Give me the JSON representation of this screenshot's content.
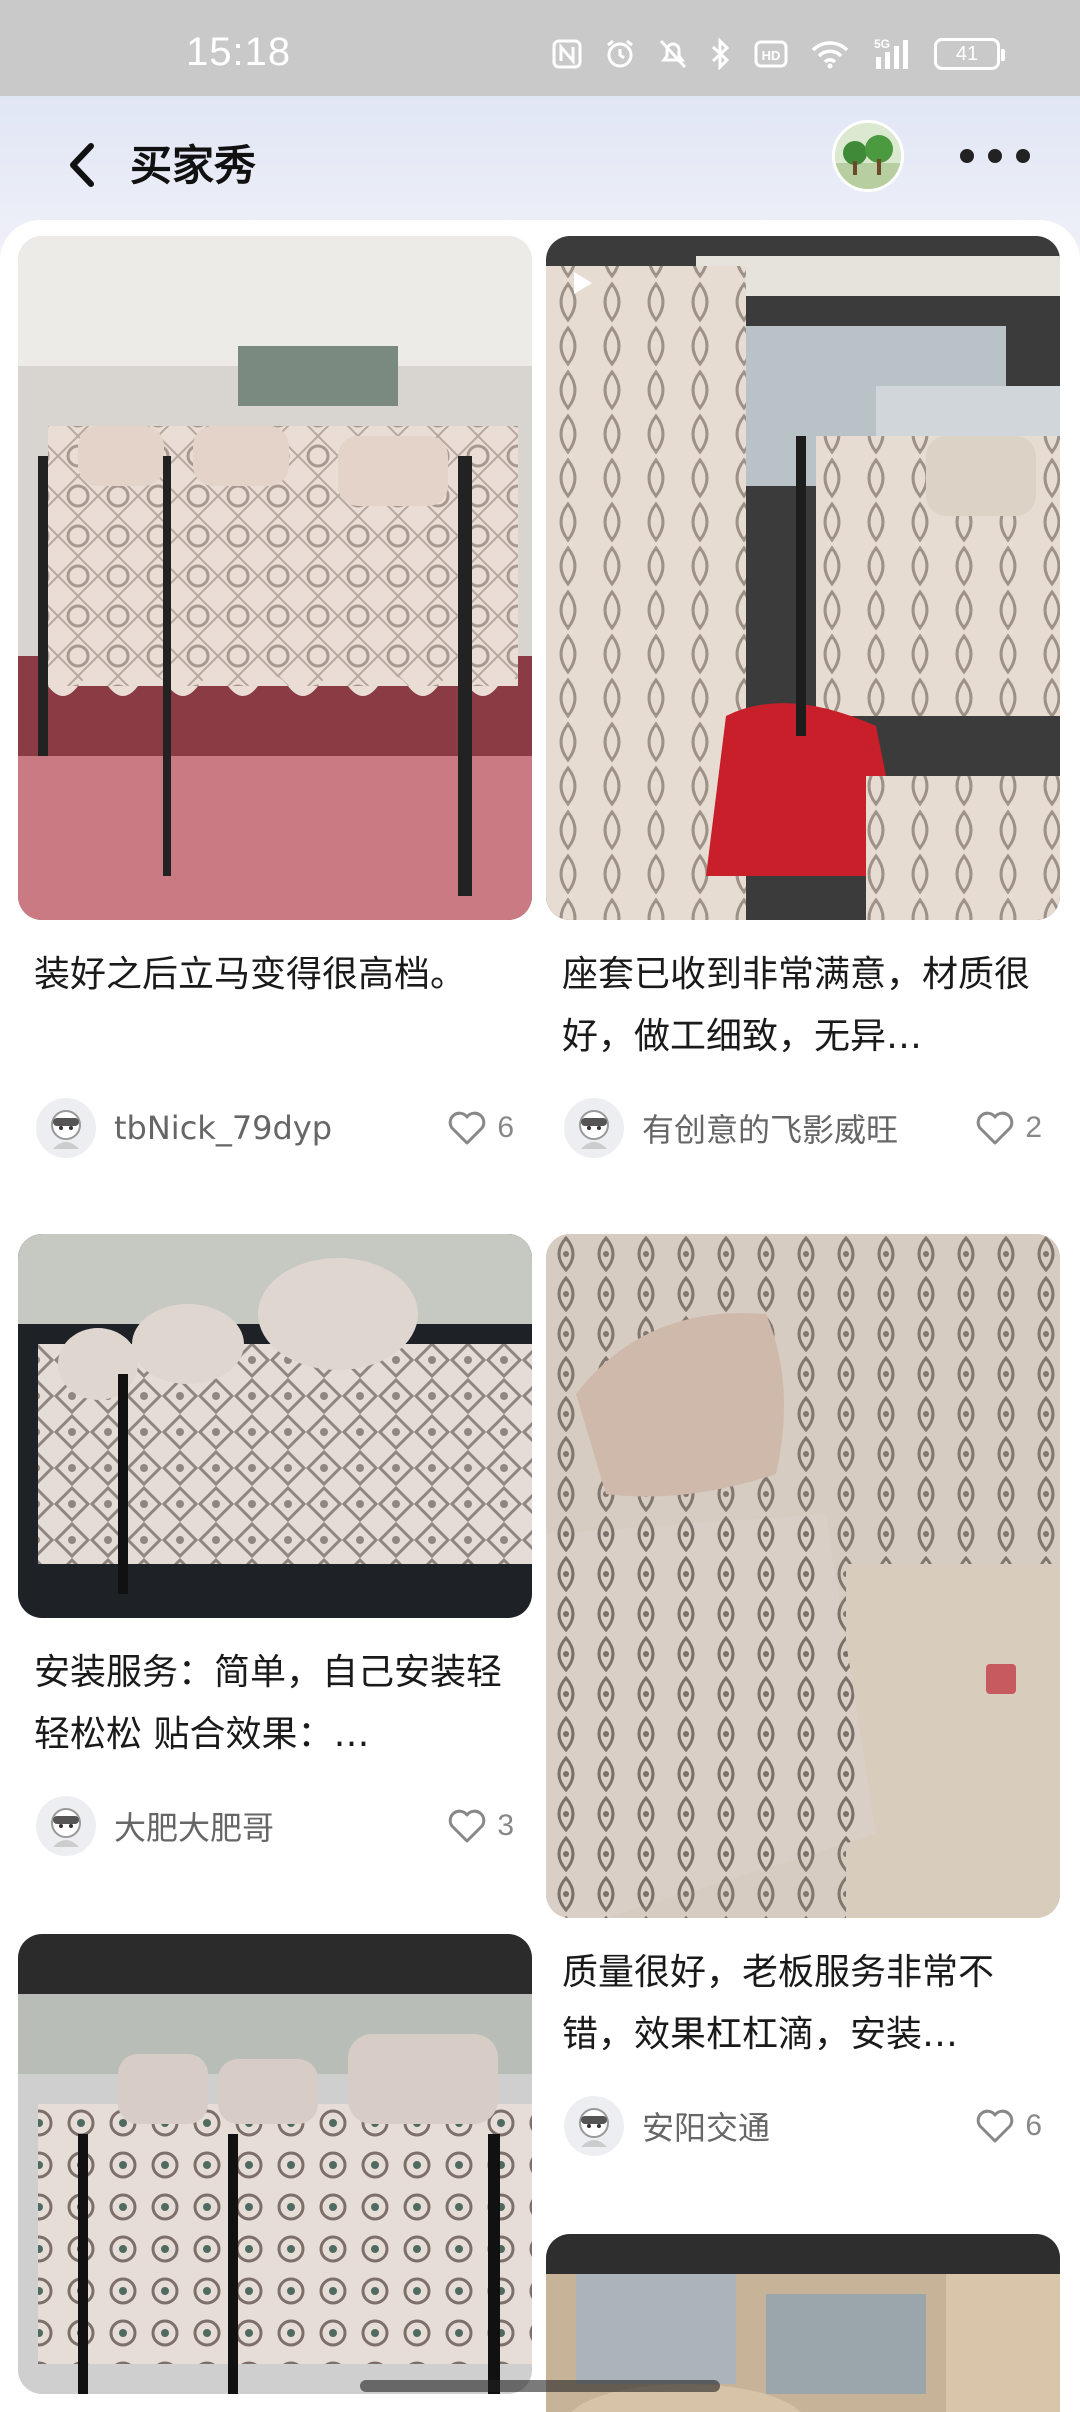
{
  "status_bar": {
    "time": "15:18",
    "network": "5G",
    "battery": "41",
    "icons": [
      "nfc-icon",
      "alarm-icon",
      "mute-icon",
      "bluetooth-icon",
      "hd-icon",
      "wifi-icon",
      "signal-icon",
      "battery-icon"
    ]
  },
  "header": {
    "title": "买家秀",
    "icons": [
      "back-arrow-icon",
      "avatar",
      "more-icon"
    ]
  },
  "posts": [
    {
      "text": "装好之后立马变得很高档。",
      "user": "tbNick_79dyp",
      "likes": "6",
      "image_desc": "car-rear-seat-lace-cover-burgundy"
    },
    {
      "text": "座套已收到非常满意，材质很好，做工细致，无异…",
      "user": "有创意的飞影威旺",
      "likes": "2",
      "image_desc": "car-front-seat-lace-cover-red-cushion",
      "video": true
    },
    {
      "text": "安装服务：简单，自己安装轻轻松松 贴合效果：…",
      "user": "大肥大肥哥",
      "likes": "3",
      "image_desc": "car-rear-seat-lace-cover-dark"
    },
    {
      "text": "质量很好，老板服务非常不错，效果杠杠滴，安装…",
      "user": "安阳交通",
      "likes": "6",
      "image_desc": "car-front-seat-lace-cover-beige"
    },
    {
      "text": "",
      "user": "",
      "likes": "",
      "image_desc": "car-rear-seat-lace-cover-patterned"
    },
    {
      "text": "",
      "user": "",
      "likes": "",
      "image_desc": "car-interior-beige-partial"
    }
  ],
  "colors": {
    "status_bar": "#c9c9c9",
    "header_bg": "#e1e6f5",
    "text": "#1a1a1a",
    "meta": "#666666"
  }
}
